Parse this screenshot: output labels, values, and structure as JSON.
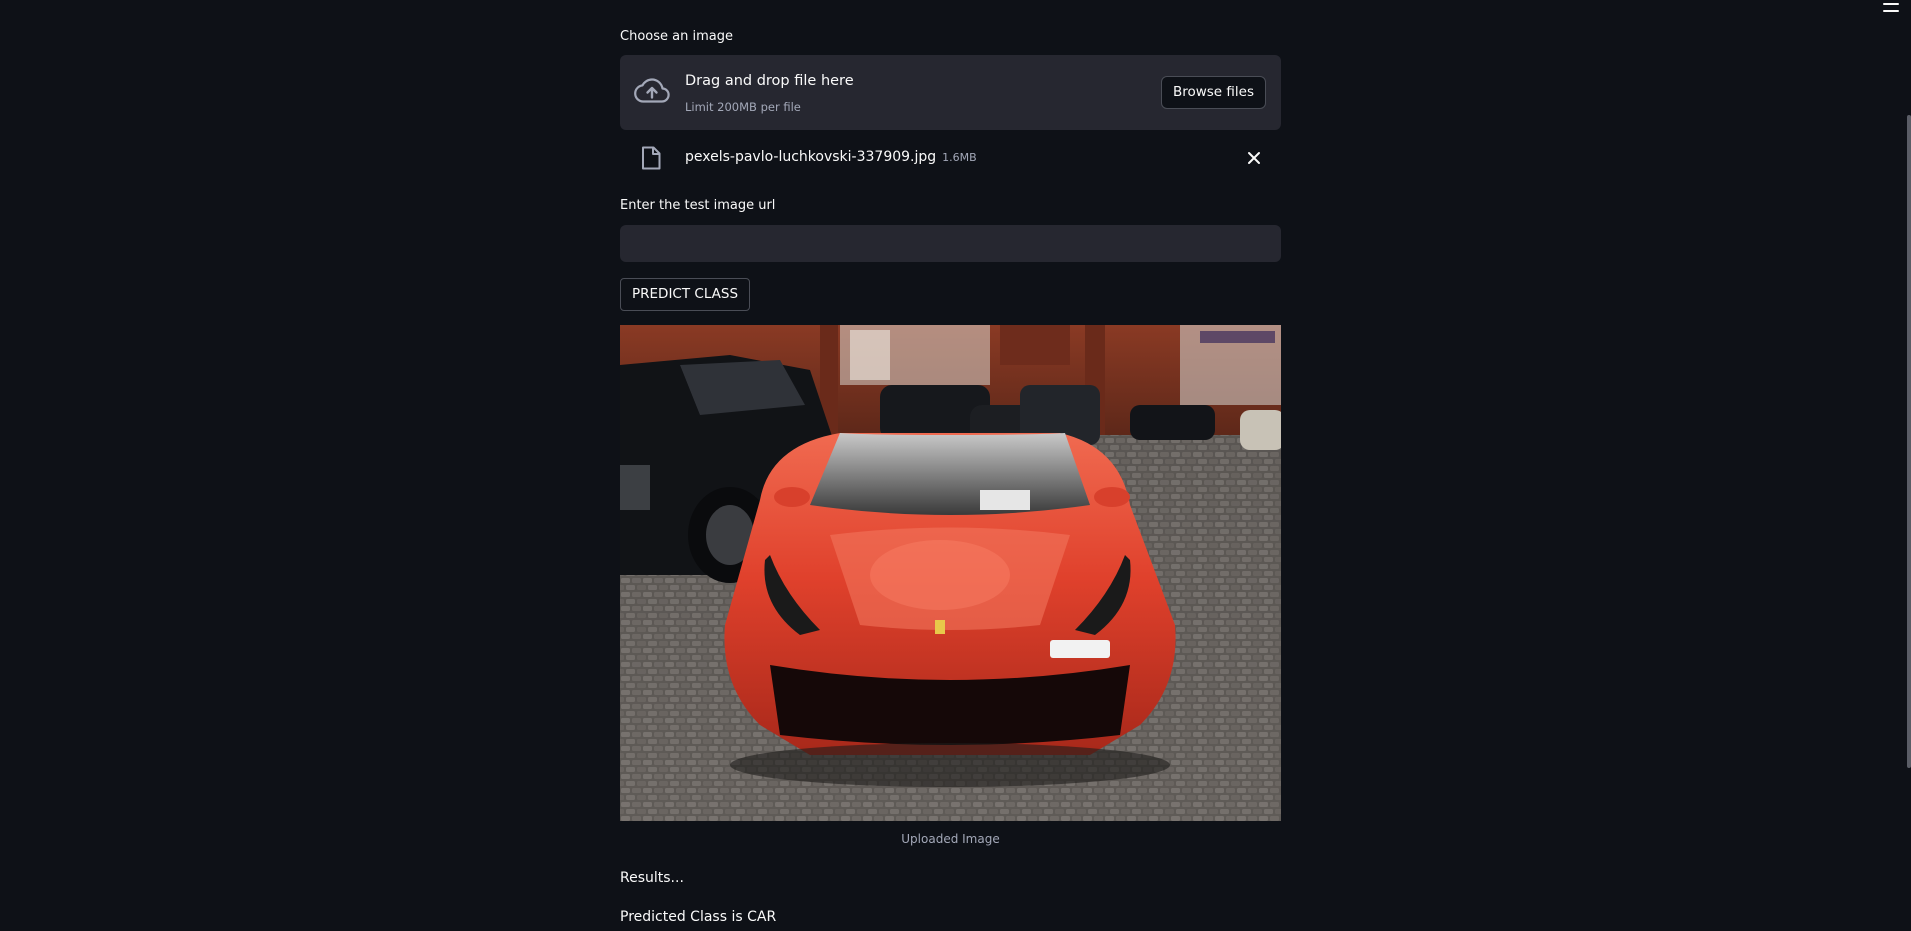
{
  "uploader": {
    "label": "Choose an image",
    "dropzone_title": "Drag and drop file here",
    "dropzone_limit": "Limit 200MB per file",
    "browse_label": "Browse files",
    "upload_icon": "cloud-upload-icon"
  },
  "uploaded_file": {
    "name": "pexels-pavlo-luchkovski-337909.jpg",
    "size": "1.6MB",
    "file_icon": "file-icon",
    "remove_icon": "close-icon"
  },
  "url_input": {
    "label": "Enter the test image url",
    "value": "",
    "placeholder": ""
  },
  "predict_button": {
    "label": "PREDICT CLASS"
  },
  "image": {
    "caption": "Uploaded Image"
  },
  "results": {
    "heading": "Results...",
    "prediction": "Predicted Class is CAR"
  },
  "colors": {
    "background": "#0e1117",
    "widget_background": "#262730",
    "text": "#fafafa",
    "muted_text": "#a3a8b8"
  }
}
